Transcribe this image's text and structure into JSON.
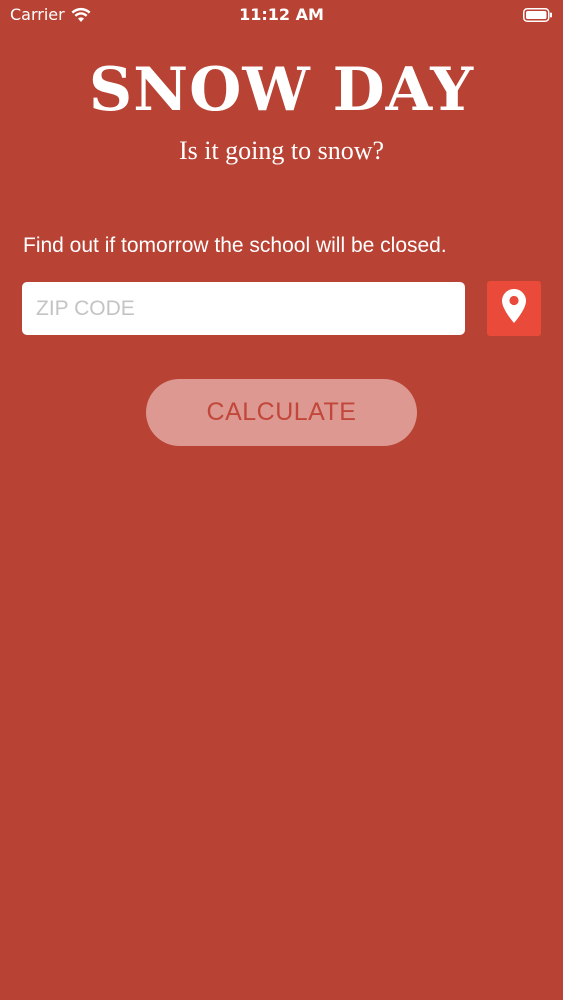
{
  "status_bar": {
    "carrier": "Carrier",
    "time": "11:12 AM"
  },
  "header": {
    "title": "SNOW DAY",
    "subtitle": "Is it going to snow?"
  },
  "form": {
    "description": "Find out if tomorrow the school will be closed.",
    "zip_placeholder": "ZIP CODE",
    "zip_value": "",
    "location_icon": "location-pin-icon",
    "calculate_label": "CALCULATE"
  },
  "colors": {
    "background": "#b84233",
    "location_button": "#e94a3a",
    "calculate_button_bg": "#dc9891",
    "calculate_button_text": "#c2473a"
  }
}
